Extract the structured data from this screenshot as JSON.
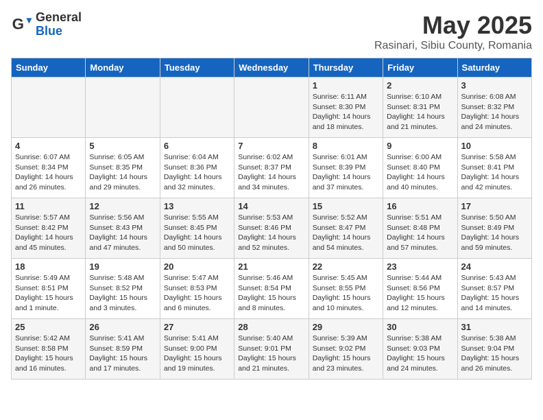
{
  "logo": {
    "general": "General",
    "blue": "Blue"
  },
  "title": "May 2025",
  "subtitle": "Rasinari, Sibiu County, Romania",
  "days_of_week": [
    "Sunday",
    "Monday",
    "Tuesday",
    "Wednesday",
    "Thursday",
    "Friday",
    "Saturday"
  ],
  "weeks": [
    [
      {
        "day": "",
        "info": ""
      },
      {
        "day": "",
        "info": ""
      },
      {
        "day": "",
        "info": ""
      },
      {
        "day": "",
        "info": ""
      },
      {
        "day": "1",
        "info": "Sunrise: 6:11 AM\nSunset: 8:30 PM\nDaylight: 14 hours\nand 18 minutes."
      },
      {
        "day": "2",
        "info": "Sunrise: 6:10 AM\nSunset: 8:31 PM\nDaylight: 14 hours\nand 21 minutes."
      },
      {
        "day": "3",
        "info": "Sunrise: 6:08 AM\nSunset: 8:32 PM\nDaylight: 14 hours\nand 24 minutes."
      }
    ],
    [
      {
        "day": "4",
        "info": "Sunrise: 6:07 AM\nSunset: 8:34 PM\nDaylight: 14 hours\nand 26 minutes."
      },
      {
        "day": "5",
        "info": "Sunrise: 6:05 AM\nSunset: 8:35 PM\nDaylight: 14 hours\nand 29 minutes."
      },
      {
        "day": "6",
        "info": "Sunrise: 6:04 AM\nSunset: 8:36 PM\nDaylight: 14 hours\nand 32 minutes."
      },
      {
        "day": "7",
        "info": "Sunrise: 6:02 AM\nSunset: 8:37 PM\nDaylight: 14 hours\nand 34 minutes."
      },
      {
        "day": "8",
        "info": "Sunrise: 6:01 AM\nSunset: 8:39 PM\nDaylight: 14 hours\nand 37 minutes."
      },
      {
        "day": "9",
        "info": "Sunrise: 6:00 AM\nSunset: 8:40 PM\nDaylight: 14 hours\nand 40 minutes."
      },
      {
        "day": "10",
        "info": "Sunrise: 5:58 AM\nSunset: 8:41 PM\nDaylight: 14 hours\nand 42 minutes."
      }
    ],
    [
      {
        "day": "11",
        "info": "Sunrise: 5:57 AM\nSunset: 8:42 PM\nDaylight: 14 hours\nand 45 minutes."
      },
      {
        "day": "12",
        "info": "Sunrise: 5:56 AM\nSunset: 8:43 PM\nDaylight: 14 hours\nand 47 minutes."
      },
      {
        "day": "13",
        "info": "Sunrise: 5:55 AM\nSunset: 8:45 PM\nDaylight: 14 hours\nand 50 minutes."
      },
      {
        "day": "14",
        "info": "Sunrise: 5:53 AM\nSunset: 8:46 PM\nDaylight: 14 hours\nand 52 minutes."
      },
      {
        "day": "15",
        "info": "Sunrise: 5:52 AM\nSunset: 8:47 PM\nDaylight: 14 hours\nand 54 minutes."
      },
      {
        "day": "16",
        "info": "Sunrise: 5:51 AM\nSunset: 8:48 PM\nDaylight: 14 hours\nand 57 minutes."
      },
      {
        "day": "17",
        "info": "Sunrise: 5:50 AM\nSunset: 8:49 PM\nDaylight: 14 hours\nand 59 minutes."
      }
    ],
    [
      {
        "day": "18",
        "info": "Sunrise: 5:49 AM\nSunset: 8:51 PM\nDaylight: 15 hours\nand 1 minute."
      },
      {
        "day": "19",
        "info": "Sunrise: 5:48 AM\nSunset: 8:52 PM\nDaylight: 15 hours\nand 3 minutes."
      },
      {
        "day": "20",
        "info": "Sunrise: 5:47 AM\nSunset: 8:53 PM\nDaylight: 15 hours\nand 6 minutes."
      },
      {
        "day": "21",
        "info": "Sunrise: 5:46 AM\nSunset: 8:54 PM\nDaylight: 15 hours\nand 8 minutes."
      },
      {
        "day": "22",
        "info": "Sunrise: 5:45 AM\nSunset: 8:55 PM\nDaylight: 15 hours\nand 10 minutes."
      },
      {
        "day": "23",
        "info": "Sunrise: 5:44 AM\nSunset: 8:56 PM\nDaylight: 15 hours\nand 12 minutes."
      },
      {
        "day": "24",
        "info": "Sunrise: 5:43 AM\nSunset: 8:57 PM\nDaylight: 15 hours\nand 14 minutes."
      }
    ],
    [
      {
        "day": "25",
        "info": "Sunrise: 5:42 AM\nSunset: 8:58 PM\nDaylight: 15 hours\nand 16 minutes."
      },
      {
        "day": "26",
        "info": "Sunrise: 5:41 AM\nSunset: 8:59 PM\nDaylight: 15 hours\nand 17 minutes."
      },
      {
        "day": "27",
        "info": "Sunrise: 5:41 AM\nSunset: 9:00 PM\nDaylight: 15 hours\nand 19 minutes."
      },
      {
        "day": "28",
        "info": "Sunrise: 5:40 AM\nSunset: 9:01 PM\nDaylight: 15 hours\nand 21 minutes."
      },
      {
        "day": "29",
        "info": "Sunrise: 5:39 AM\nSunset: 9:02 PM\nDaylight: 15 hours\nand 23 minutes."
      },
      {
        "day": "30",
        "info": "Sunrise: 5:38 AM\nSunset: 9:03 PM\nDaylight: 15 hours\nand 24 minutes."
      },
      {
        "day": "31",
        "info": "Sunrise: 5:38 AM\nSunset: 9:04 PM\nDaylight: 15 hours\nand 26 minutes."
      }
    ]
  ]
}
